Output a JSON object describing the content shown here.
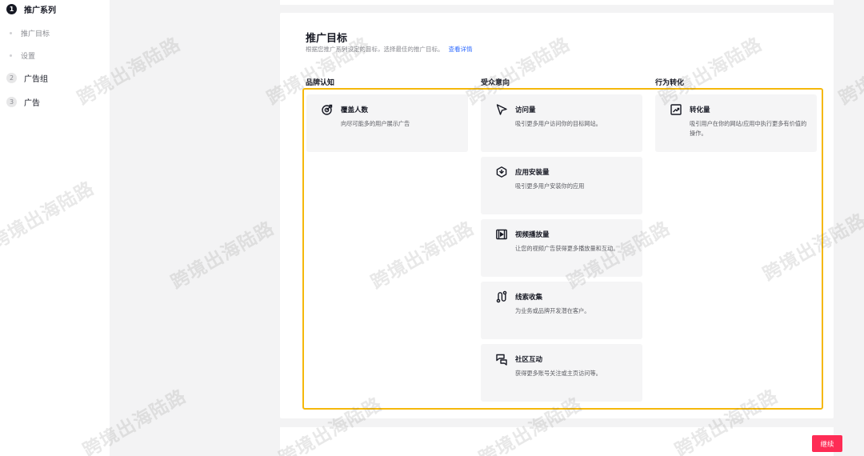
{
  "sidebar": {
    "steps": [
      {
        "num": "1",
        "label": "推广系列",
        "subs": [
          "推广目标",
          "设置"
        ]
      },
      {
        "num": "2",
        "label": "广告组"
      },
      {
        "num": "3",
        "label": "广告"
      }
    ]
  },
  "main": {
    "title": "推广目标",
    "subtitle": "根据您推广系列设定的目标，选择最佳的推广目标。",
    "learn_more": "查看详情",
    "columns": [
      {
        "heading": "品牌认知",
        "cards": [
          {
            "icon": "target-icon",
            "title": "覆盖人数",
            "desc": "向尽可能多的用户展示广告"
          }
        ]
      },
      {
        "heading": "受众意向",
        "cards": [
          {
            "icon": "cursor-arrow-icon",
            "title": "访问量",
            "desc": "吸引更多用户访问你的目标网站。"
          },
          {
            "icon": "app-cube-icon",
            "title": "应用安装量",
            "desc": "吸引更多用户安装你的应用"
          },
          {
            "icon": "video-film-icon",
            "title": "视频播放量",
            "desc": "让您的视频广告获得更多播放量和互动。"
          },
          {
            "icon": "lead-path-icon",
            "title": "线索收集",
            "desc": "为业务或品牌开发潜在客户。"
          },
          {
            "icon": "community-chat-icon",
            "title": "社区互动",
            "desc": "获得更多账号关注或主页访问等。"
          }
        ]
      },
      {
        "heading": "行为转化",
        "cards": [
          {
            "icon": "trend-chart-icon",
            "title": "转化量",
            "desc": "吸引用户在你的网站/应用中执行更多有价值的操作。"
          }
        ]
      }
    ]
  },
  "footer": {
    "continue_label": "继续"
  },
  "watermark": "跨境出海陆路",
  "colors": {
    "accent": "#fe2c55",
    "selection_border": "#f5b80b",
    "link": "#2f6bff"
  }
}
